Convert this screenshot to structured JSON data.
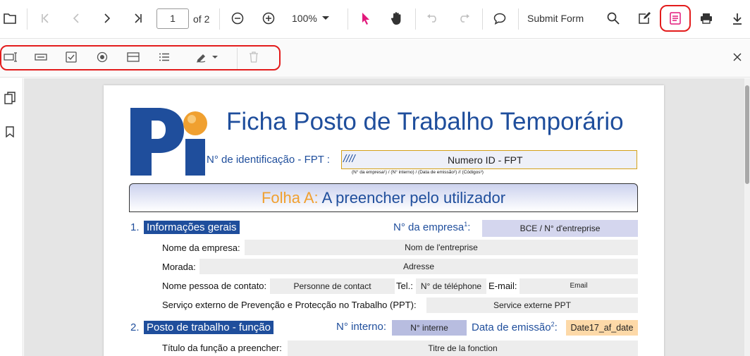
{
  "toolbar": {
    "page_number": "1",
    "page_total": "of 2",
    "zoom": "100%",
    "submit_form": "Submit Form"
  },
  "document": {
    "title": "Ficha Posto de Trabalho Temporário",
    "fpt_label": "N° de identificação - FPT :",
    "fpt_slashes": "////",
    "fpt_value": "Numero ID - FPT",
    "fpt_hint": "(N° da empresa¹)  /  (N° interno)  /    (Data de emissão²)    //     (Códigos³)",
    "folha_prefix": "Folha A:",
    "folha_text": "A preencher pelo utilizador",
    "section1": {
      "number": "1.",
      "title": "Informações gerais",
      "empresa_label": "N° da empresa",
      "empresa_sup": "1",
      "empresa_colon": ":",
      "empresa_value": "BCE / N° d'entreprise",
      "nome_label": "Nome da empresa:",
      "nome_value": "Nom de l'entreprise",
      "morada_label": "Morada:",
      "morada_value": "Adresse",
      "contato_label": "Nome pessoa de contato:",
      "contato_value": "Personne de contact",
      "tel_label": "Tel.:",
      "tel_value": "N° de téléphone",
      "email_label": "E-mail:",
      "email_value": "Email",
      "servico_label": "Serviço externo de Prevenção e Protecção no Trabalho (PPT):",
      "servico_value": "Service externe PPT"
    },
    "section2": {
      "number": "2.",
      "title": "Posto de trabalho - função",
      "interno_label": "N° interno:",
      "interno_value": "N° interne",
      "data_label": "Data de emissão",
      "data_sup": "2",
      "data_colon": ":",
      "data_value": "Date17_af_date",
      "titulo_label": "Título da função a preencher:",
      "titulo_value": "Titre de la fonction"
    }
  },
  "colors": {
    "accent_blue": "#1f4e9c",
    "highlight_red": "#e31c1c",
    "folha_orange": "#f0a030",
    "date_field": "#fdd9a8",
    "field_lavender": "#d4d6ee"
  }
}
